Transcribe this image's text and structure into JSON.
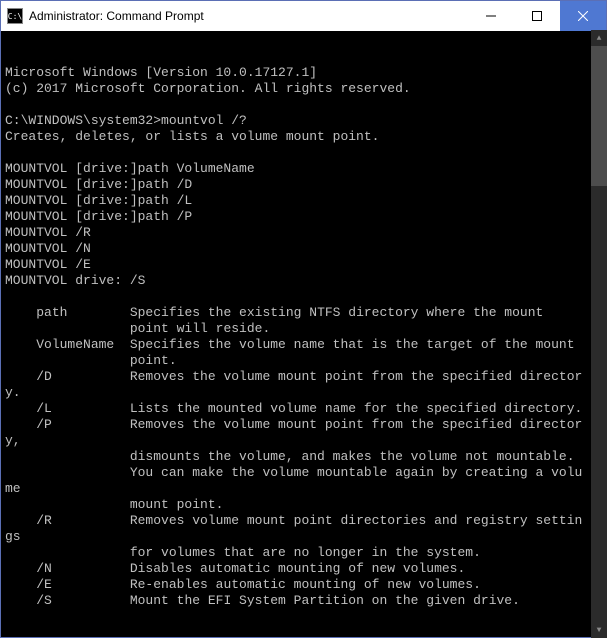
{
  "titlebar": {
    "icon_label": "C:\\",
    "title": "Administrator: Command Prompt"
  },
  "terminal": {
    "lines": [
      "Microsoft Windows [Version 10.0.17127.1]",
      "(c) 2017 Microsoft Corporation. All rights reserved.",
      "",
      "C:\\WINDOWS\\system32>mountvol /?",
      "Creates, deletes, or lists a volume mount point.",
      "",
      "MOUNTVOL [drive:]path VolumeName",
      "MOUNTVOL [drive:]path /D",
      "MOUNTVOL [drive:]path /L",
      "MOUNTVOL [drive:]path /P",
      "MOUNTVOL /R",
      "MOUNTVOL /N",
      "MOUNTVOL /E",
      "MOUNTVOL drive: /S",
      "",
      "    path        Specifies the existing NTFS directory where the mount",
      "                point will reside.",
      "    VolumeName  Specifies the volume name that is the target of the mount",
      "                point.",
      "    /D          Removes the volume mount point from the specified directory.",
      "    /L          Lists the mounted volume name for the specified directory.",
      "    /P          Removes the volume mount point from the specified directory,",
      "                dismounts the volume, and makes the volume not mountable.",
      "                You can make the volume mountable again by creating a volume",
      "                mount point.",
      "    /R          Removes volume mount point directories and registry settings",
      "                for volumes that are no longer in the system.",
      "    /N          Disables automatic mounting of new volumes.",
      "    /E          Re-enables automatic mounting of new volumes.",
      "    /S          Mount the EFI System Partition on the given drive."
    ]
  }
}
